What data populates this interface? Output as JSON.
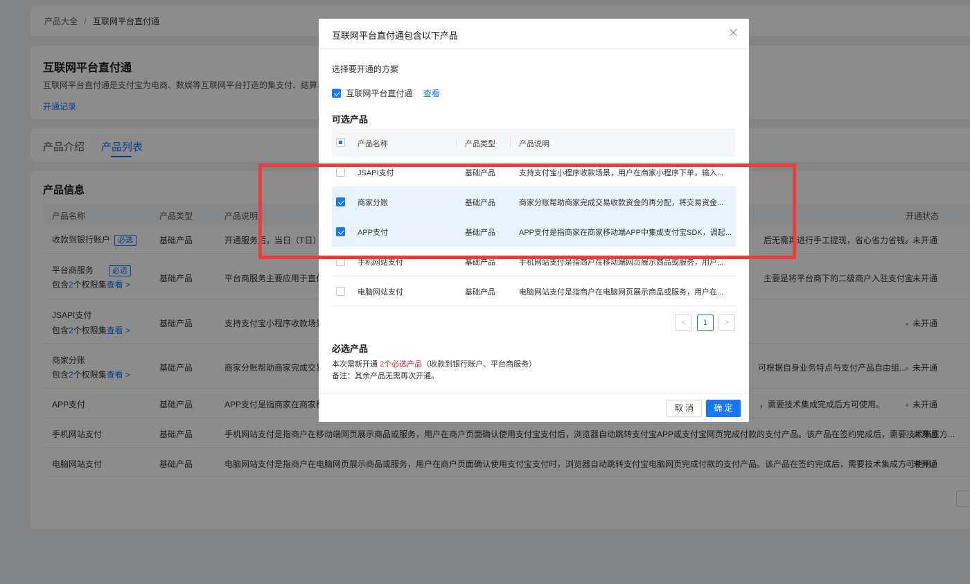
{
  "breadcrumb": {
    "root": "产品大全",
    "separator": "/",
    "current": "互联网平台直付通"
  },
  "header": {
    "title": "互联网平台直付通",
    "description": "互联网平台直付通是支付宝为电商、数娱等互联网平台打造的集支付、结算、分账等",
    "record_link": "开通记录"
  },
  "tabs": [
    {
      "label": "产品介绍"
    },
    {
      "label": "产品列表"
    }
  ],
  "product_info": {
    "title": "产品信息",
    "columns": {
      "name": "产品名称",
      "type": "产品类型",
      "desc": "产品说明",
      "status": "开通状态"
    },
    "rows": [
      {
        "name": "收款到银行账户",
        "badge": "必选",
        "type": "基础产品",
        "desc_left": "开通服务后，当日（T日）收",
        "desc_right": "后无需再进行手工提现，省心省力省钱。",
        "status": "未开通"
      },
      {
        "name": "平台商服务",
        "badge": "必选",
        "sub_prefix": "包含",
        "sub_num": "2",
        "sub_mid": "个权限集",
        "sub_link": "查看 >",
        "type": "基础产品",
        "desc_left": "平台商服务主要应用于直付通",
        "desc_right": "主要是将平台商下的二级商户入驻支付宝...",
        "status": "未开通"
      },
      {
        "name": "JSAPI支付",
        "sub_prefix": "包含",
        "sub_num": "2",
        "sub_mid": "个权限集",
        "sub_link": "查看 >",
        "type": "基础产品",
        "desc_left": "支持支付宝小程序收款场景，",
        "desc_right": "",
        "status": "未开通"
      },
      {
        "name": "商家分账",
        "sub_prefix": "包含",
        "sub_num": "2",
        "sub_mid": "个权限集",
        "sub_link": "查看 >",
        "type": "基础产品",
        "desc_left": "商家分账帮助商家完成交易收",
        "desc_right": "可根据自身业务特点与支付产品自由组...",
        "status": "未开通"
      },
      {
        "name": "APP支付",
        "type": "基础产品",
        "desc_left": "APP支付是指商家在商家移动",
        "desc_right": "，需要技术集成完成后方可使用。",
        "status": "未开通"
      },
      {
        "name": "手机网站支付",
        "type": "基础产品",
        "desc_left": "手机网站支付是指商户在移动端网页展示商品或服务，用户在商户页面确认使用支付宝支付后，浏览器自动跳转支付宝APP或支付宝网页完成付款的支付产品。该产品在签约完成后，需要技术集成方...",
        "desc_right": "",
        "status": "未开通"
      },
      {
        "name": "电脑网站支付",
        "type": "基础产品",
        "desc_left": "电脑网站支付是指商户在电脑网页展示商品或服务，用户在商户页面确认使用支付宝支付时，浏览器自动跳转支付宝电脑网页完成付款的支付产品。该产品在签约完成后，需要技术集成方可使用。",
        "desc_right": "",
        "status": "未开通"
      }
    ]
  },
  "modal": {
    "title": "互联网平台直付通包含以下产品",
    "scheme_label": "选择要开通的方案",
    "scheme": {
      "name": "互联网平台直付通",
      "link": "查看",
      "checked": true
    },
    "optional_title": "可选产品",
    "columns": {
      "name": "产品名称",
      "type": "产品类型",
      "desc": "产品说明"
    },
    "rows": [
      {
        "name": "JSAPI支付",
        "type": "基础产品",
        "desc": "支持支付宝小程序收款场景，用户在商家小程序下单，输入...",
        "checked": false
      },
      {
        "name": "商家分账",
        "type": "基础产品",
        "desc": "商家分账帮助商家完成交易收款资金的再分配，将交易资金...",
        "checked": true
      },
      {
        "name": "APP支付",
        "type": "基础产品",
        "desc": "APP支付是指商家在商家移动端APP中集成支付宝SDK，调起...",
        "checked": true
      },
      {
        "name": "手机网站支付",
        "type": "基础产品",
        "desc": "手机网站支付是指商户在移动端网页展示商品或服务，用户...",
        "checked": false
      },
      {
        "name": "电脑网站支付",
        "type": "基础产品",
        "desc": "电脑网站支付是指商户在电脑网页展示商品或服务，用户在...",
        "checked": false
      }
    ],
    "pagination": {
      "prev": "<",
      "page": "1",
      "next": ">"
    },
    "required_title": "必选产品",
    "required_prefix": "本次需新开通 ",
    "required_highlight": "2个必选产品",
    "required_suffix": "（收款到银行账户、平台商服务）",
    "note": "备注：其余产品无需再次开通。",
    "cancel": "取 消",
    "confirm": "确 定"
  }
}
